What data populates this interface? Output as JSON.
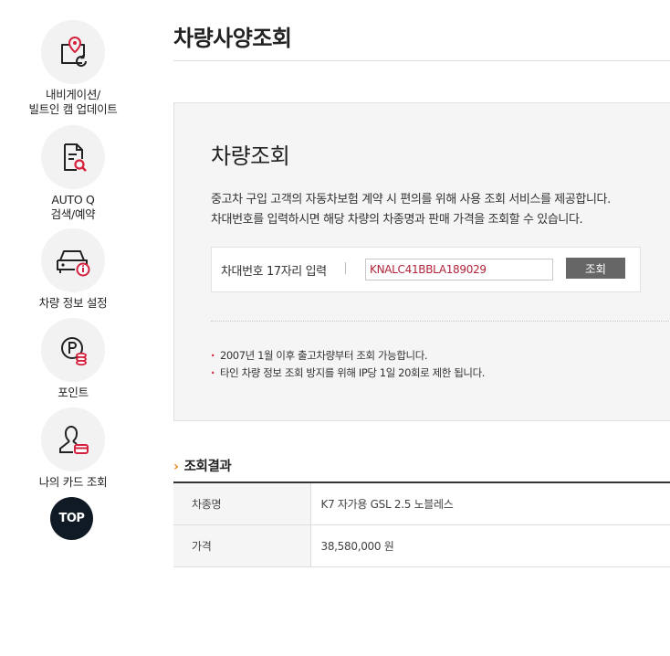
{
  "sidebar": {
    "items": [
      {
        "label_line1": "내비게이션/",
        "label_line2": "빌트인 캠 업데이트",
        "icon": "map-pin-refresh-icon"
      },
      {
        "label_line1": "AUTO Q",
        "label_line2": "검색/예약",
        "icon": "document-search-icon"
      },
      {
        "label_line1": "차량 정보 설정",
        "icon": "car-info-icon"
      },
      {
        "label_line1": "포인트",
        "icon": "point-coin-icon"
      },
      {
        "label_line1": "나의 카드 조회",
        "icon": "user-card-icon"
      }
    ],
    "top_label": "TOP"
  },
  "page": {
    "title": "차량사양조회"
  },
  "search": {
    "title": "차량조회",
    "desc_line1": "중고차 구입 고객의 자동차보험 계약 시 편의를 위해 사용 조회 서비스를 제공합니다.",
    "desc_line2": "차대번호를 입력하시면 해당 차량의 차종명과 판매 가격을 조회할 수 있습니다.",
    "input_label": "차대번호 17자리 입력",
    "input_value": "KNALC41BBLA189029",
    "button_label": "조회",
    "notes": [
      "2007년 1월 이후 출고차량부터 조회 가능합니다.",
      "타인 차량 정보 조회 방지를 위해 IP당 1일 20회로 제한 됩니다."
    ]
  },
  "result": {
    "heading": "조회결과",
    "rows": [
      {
        "label": "차종명",
        "value": "K7 자가용 GSL 2.5 노블레스"
      },
      {
        "label": "가격",
        "value": "38,580,000 원"
      }
    ]
  },
  "colors": {
    "accent_red": "#d4213d",
    "accent_orange": "#f08a1c",
    "top_button": "#0f1a24"
  }
}
